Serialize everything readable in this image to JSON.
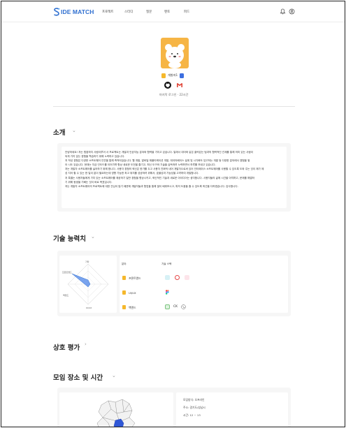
{
  "nav": {
    "logo": "IDE MATCH",
    "items": [
      "프로젝트",
      "스터디",
      "질문",
      "멘토",
      "피드"
    ]
  },
  "profile": {
    "nickname": "개발자1",
    "last_login": "마지막 로그인 · 22시간"
  },
  "intro": {
    "title": "소개",
    "lines": [
      "안녕하세요! 저는 힘찹하지 사람이루어 서 프로젝트는 개발과 인공지능 분야와 협력을 가지고 있습니다. 일에서 대어와 같은 클릭있는 팀과의 협력적인 관계를 통해 의미 있는 사람이",
      "되게 가지 않는 경험을 학습하기 위해 노력하고 있습니다.",
      "저 작성 경험은 다양한 소프트웨어 인연을 통해 축적되었습니다. 웹 개발, 알바일 애플리케이션 개발, 데이터베이스 설계 및 시각화도 담고하는 개발 등 다양한 분야에서 경험을 쌓",
      "아 시도 있습니다. 현재는 지금 인도드를 이어가며 항상 새로운 도전을 즐기고, 최신 도구와 기술을 습득하려 노력하면서 하루를 보내고 있습니다.",
      "저는 개발자 소프트웨어를 싫어하기 위해 합니다. 사용자 경험의 혁신은 한가를 두고 사용자 친화적 네어 개발자으로써 있어 인터페이스 소프트웨어를 사용할 수 있도록 도와 주는 것이 제가 제",
      "성 지어 할 수 있는 한 일이 없이 필요하는데 영향 가능한 최고 위치를 성공하려 위해서, 효율성과 가능성을 고려하여 개발합니다.",
      "저 특별는 사용자들에게 가치 있는 소프트웨어를 제공하기 일반 경험을 향상시키고, 혁신적인 기술과 새로운 아이디어는 생각합니다. 사용자들의 삶에 시간을 아끼며고, 문제를 해결하",
      "기 위해 동생을 기뻐는 것이 바로 목표입니다.",
      "저는 개발자 소프트웨어의 프로젝트에 대한 관심이 많기 때문에 개발자들과 협업을 통해 많이 배워보시고, 특히 도움을 줄 수 있도록 최선을 다하겠습니다. 감사합니다."
    ]
  },
  "skills": {
    "title": "기술 능력치",
    "radar_labels": [
      "프론트엔드",
      "백엔드",
      "UI/UX",
      "기타"
    ],
    "col_area": "분야",
    "col_stack": "기술 스택",
    "rows": [
      "프론트엔드",
      "UI/UX",
      "백엔드"
    ],
    "backend_tech_text": "CK"
  },
  "review": {
    "title": "상호 평가"
  },
  "meeting": {
    "title": "모임 장소 및 시간",
    "method": "모임방식: 오프라인",
    "place": "주소: 경기도/성남시",
    "time": "시간: 12 ~ 13"
  }
}
